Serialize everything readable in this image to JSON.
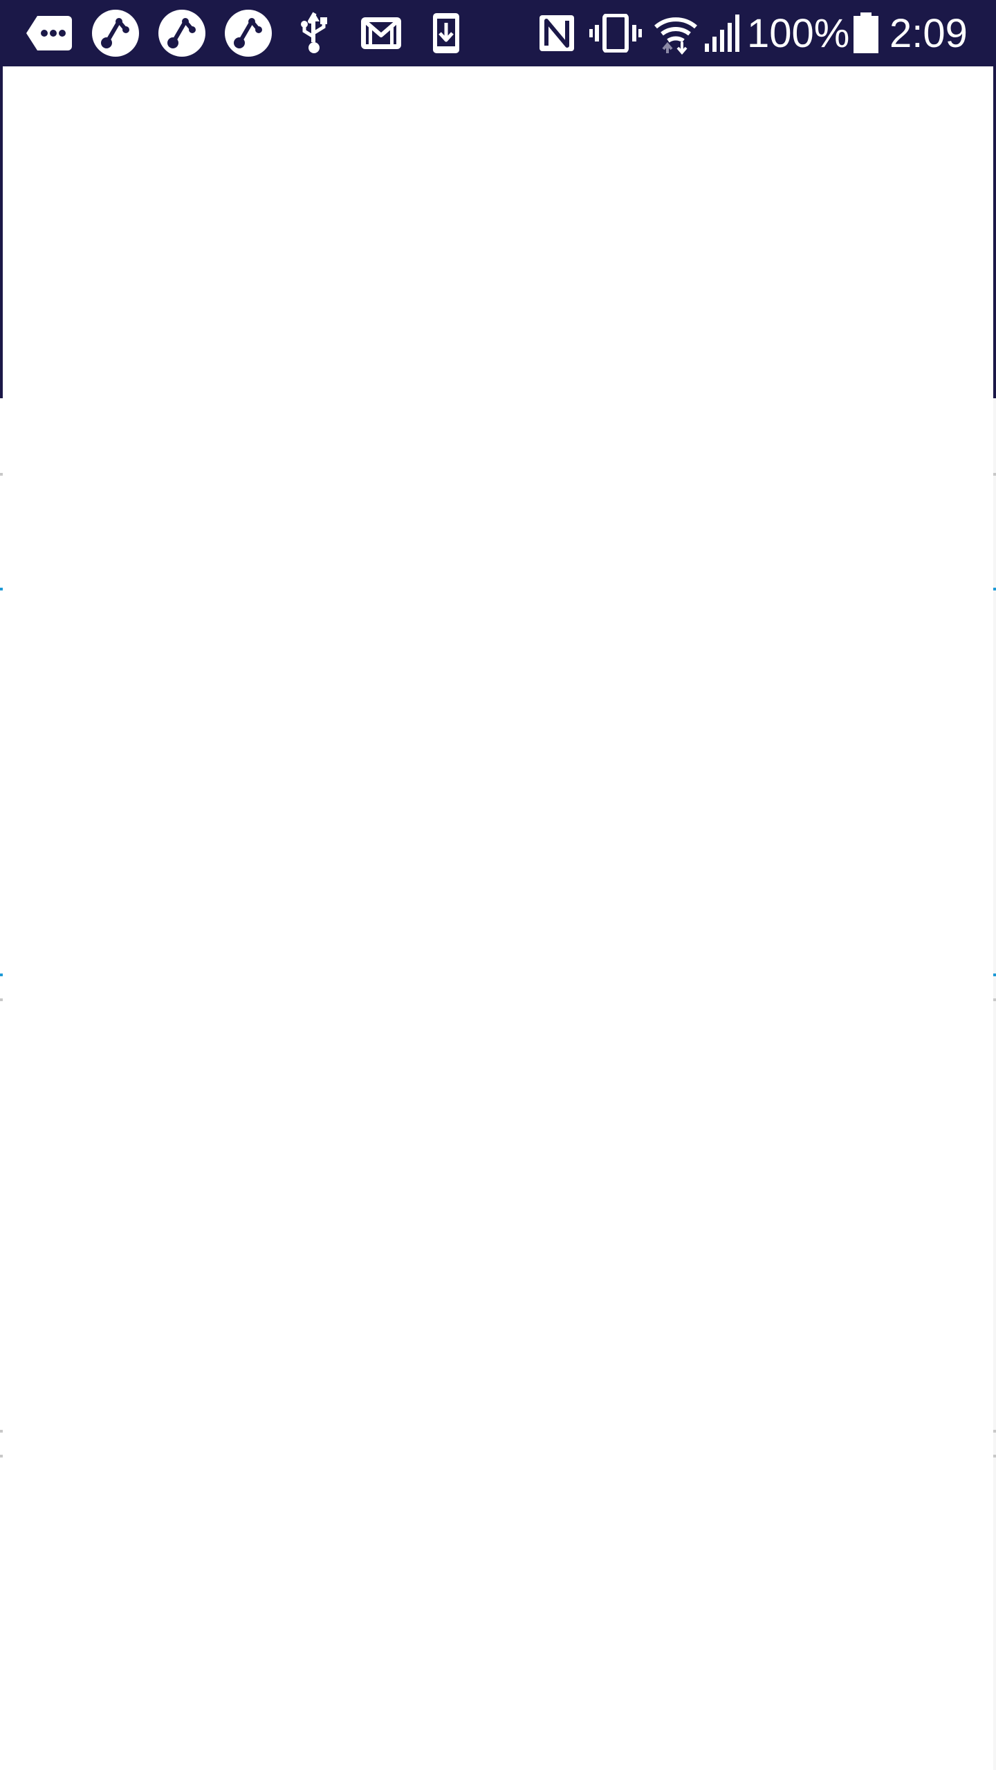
{
  "status_bar": {
    "battery_percent": "100%",
    "time": "2:09",
    "background_color": "#1b1848",
    "icons_left": [
      "more-notifications-icon",
      "shared-app-icon",
      "shared-app-icon",
      "shared-app-icon",
      "usb-icon",
      "gmail-icon",
      "download-icon"
    ],
    "icons_right": [
      "nfc-icon",
      "vibrate-icon",
      "wifi-icon",
      "cell-signal-icon",
      "battery-icon"
    ]
  },
  "content": {
    "background_color": "#ffffff",
    "accent_color": "#1e9ad6"
  }
}
